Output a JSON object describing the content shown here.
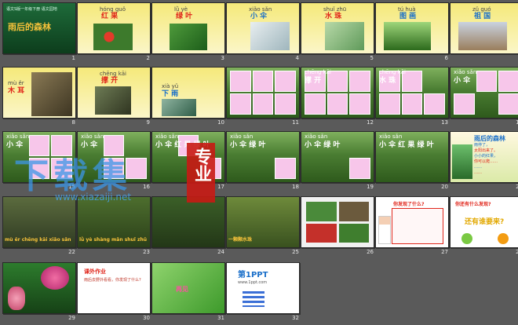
{
  "slides": [
    {
      "n": "1",
      "title": "雨后的森林",
      "sub": "语文S版一年级下册 语文园地"
    },
    {
      "n": "2",
      "pinyin": "hóng guǒ",
      "hanzi": "红 果"
    },
    {
      "n": "3",
      "pinyin": "lǜ yè",
      "hanzi": "绿 叶"
    },
    {
      "n": "4",
      "pinyin": "xiǎo sǎn",
      "hanzi": "小 伞"
    },
    {
      "n": "5",
      "pinyin": "shuǐ zhū",
      "hanzi": "水 珠"
    },
    {
      "n": "6",
      "pinyin": "tú huà",
      "hanzi": "图 画"
    },
    {
      "n": "7",
      "pinyin": "zǔ guó",
      "hanzi": "祖 国"
    },
    {
      "n": "8",
      "pinyin": "mù ěr",
      "hanzi": "木 耳"
    },
    {
      "n": "9",
      "pinyin": "chēng kāi",
      "hanzi": "撑 开"
    },
    {
      "n": "10",
      "pinyin": "xià yǔ",
      "hanzi": "下 雨"
    },
    {
      "n": "11"
    },
    {
      "n": "12",
      "pinyin": "chēng kāi",
      "hanzi": "撑 开"
    },
    {
      "n": "13",
      "pinyin": "chēng kāi",
      "hanzi": "水 珠"
    },
    {
      "n": "14",
      "pinyin": "xiǎo sǎn",
      "hanzi": "小 伞"
    },
    {
      "n": "15",
      "pinyin": "xiǎo sǎn",
      "hanzi": "小 伞"
    },
    {
      "n": "16",
      "pinyin": "xiǎo sǎn",
      "hanzi": "小 伞"
    },
    {
      "n": "17",
      "pinyin": "xiǎo sǎn",
      "hanzi": "小 伞 红 果 绿 叶"
    },
    {
      "n": "18",
      "pinyin": "xiǎo sǎn",
      "hanzi": "小 伞 绿 叶"
    },
    {
      "n": "19",
      "pinyin": "xiǎo sǎn",
      "hanzi": "小 伞 绿 叶"
    },
    {
      "n": "20",
      "pinyin": "xiǎo sǎn",
      "hanzi": "小 伞 红 果 绿 叶"
    },
    {
      "n": "21",
      "title": "雨后的森林",
      "lines": [
        "雨停了，",
        "太阳出来了。",
        "小小的红果，",
        "你可以爬……",
        "……",
        "……"
      ]
    },
    {
      "n": "22",
      "caption": "mù ěr chēng kāi xiǎo sǎn"
    },
    {
      "n": "23",
      "caption": "lǜ yè shàng mǎn shuǐ zhū"
    },
    {
      "n": "24"
    },
    {
      "n": "25",
      "caption": "一颗颗水珠"
    },
    {
      "n": "26"
    },
    {
      "n": "27",
      "title": "你发现了什么?"
    },
    {
      "n": "28",
      "title": "你还有什么发现?",
      "sub": "还有谁要来?"
    },
    {
      "n": "29"
    },
    {
      "n": "30",
      "title": "课外作业",
      "body": "雨后去野外看看，你发现了什么?"
    },
    {
      "n": "31",
      "title": "再见"
    },
    {
      "n": "32",
      "title": "第1PPT",
      "sub": "www.1ppt.com"
    }
  ],
  "watermark": {
    "big": "下载集",
    "side": "专业",
    "url": "www.xiazaiji.net"
  },
  "colors": {
    "bg": "#5a5a5a",
    "pink": "#f7c6ea",
    "red": "#e0261b",
    "green": "#2f9a2f"
  }
}
